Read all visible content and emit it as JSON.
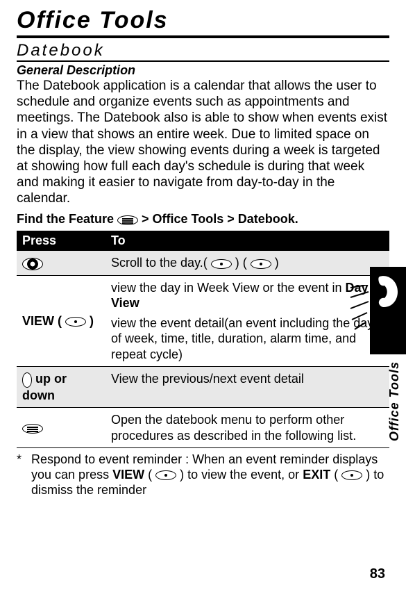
{
  "chapter": "Office Tools",
  "section": "Datebook",
  "subsection": "General Description",
  "description": "The Datebook application is a calendar that allows the user to schedule and organize events such as appointments and meetings. The Datebook also is able to show when events exist in a view that shows an entire week. Due to limited space on the display, the view showing events during a week is targeted at showing how full each day's schedule is during that week and making it easier to navigate from day-to-day in the calendar.",
  "find_feature_label": "Find the Feature",
  "find_feature_path": " > Office Tools > Datebook.",
  "table": {
    "headers": {
      "press": "Press",
      "to": "To"
    },
    "rows": [
      {
        "press_icon": "scroll-wheel",
        "to_pre": "Scroll to the day.( ",
        "to_mid": " ) ( ",
        "to_post": " )"
      },
      {
        "press_label_pre": "VIEW ( ",
        "press_label_post": " )",
        "to_line1": "view the day in Week View or the event in ",
        "to_line1_bold": "Day View",
        "to_line2": "view the event detail(an event including the day of week, time, title, duration, alarm time, and repeat cycle)"
      },
      {
        "press_suffix": " up or down",
        "to": "View the previous/next event detail"
      },
      {
        "press_icon": "menu",
        "to": "Open the datebook menu to perform other procedures as described in the following list."
      }
    ]
  },
  "footnote": {
    "marker": "*",
    "pre": "Respond to event reminder : When an event reminder displays you can press ",
    "view": "VIEW",
    "mid1": " ( ",
    "mid2": " ) to view the event, or ",
    "exit": "EXIT",
    "mid3": " ( ",
    "post": " ) to dismiss the reminder"
  },
  "side_label": "Office Tools",
  "page_number": "83"
}
